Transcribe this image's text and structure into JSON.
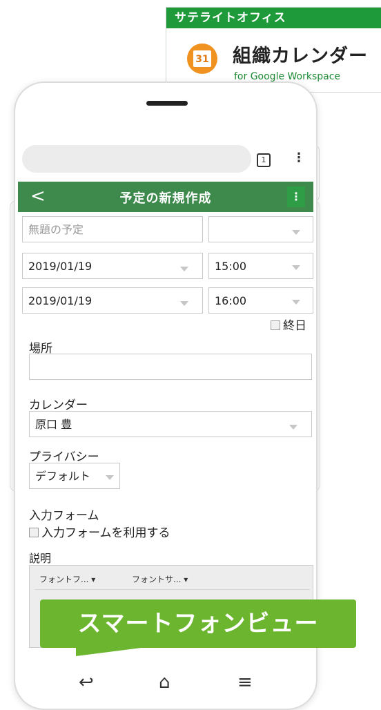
{
  "logo": {
    "brand": "サテライトオフィス",
    "product": "組織カレンダー",
    "subtitle": "for Google Workspace",
    "calendar_day": "31"
  },
  "browser": {
    "tab_count": "1",
    "menu_glyph": "⋮"
  },
  "header": {
    "back_glyph": "<",
    "title": "予定の新規作成",
    "menu_glyph": "⋮"
  },
  "form": {
    "title_placeholder": "無題の予定",
    "start_date": "2019/01/19",
    "start_time": "15:00",
    "end_date": "2019/01/19",
    "end_time": "16:00",
    "all_day_label": "終日",
    "location_label": "場所",
    "location_value": "",
    "calendar_label": "カレンダー",
    "calendar_value": "原口 豊",
    "privacy_label": "プライバシー",
    "privacy_value": "デフォルト",
    "input_form_label": "入力フォーム",
    "use_input_form_label": "入力フォームを利用する",
    "description_label": "説明"
  },
  "editor": {
    "font_family": "フォントフ... ▾",
    "font_size": "フォントサ... ▾"
  },
  "banner": {
    "text": "スマートフォンビュー"
  },
  "nav": {
    "back": "↩",
    "home": "⌂",
    "menu": "≡"
  },
  "colors": {
    "header": "#3d8a4c",
    "banner": "#6cb52f",
    "logo_bar": "#1e9a3a",
    "logo_icon": "#f0921f"
  }
}
